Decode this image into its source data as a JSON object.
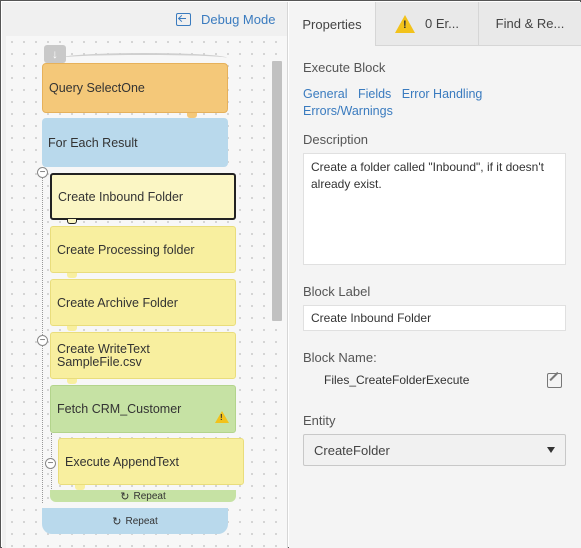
{
  "canvas": {
    "debug_label": "Debug Mode",
    "blocks": {
      "query": "Query SelectOne",
      "foreach": "For Each Result",
      "create_inbound": "Create Inbound Folder",
      "processing": "Create Processing folder",
      "archive": "Create Archive Folder",
      "writetext": "Create WriteText SampleFile.csv",
      "fetch": "Fetch CRM_Customer",
      "append": "Execute AppendText",
      "repeat_inner": "Repeat",
      "repeat_outer": "Repeat"
    },
    "colors": {
      "query": "#f4c879",
      "foreach": "#b9d9ec",
      "yellow": "#f8ef9f",
      "green": "#c6e2a4",
      "warning": "#f2c21b"
    }
  },
  "tabs": {
    "properties": "Properties",
    "errors": "0 Er...",
    "find": "Find & Re..."
  },
  "properties": {
    "section_title": "Execute Block",
    "links": [
      "General",
      "Fields",
      "Error Handling",
      "Errors/Warnings"
    ],
    "description_label": "Description",
    "description_value": "Create a folder called \"Inbound\", if it doesn't already exist.",
    "block_label_label": "Block Label",
    "block_label_value": "Create Inbound Folder",
    "block_name_label": "Block Name:",
    "block_name_value": "Files_CreateFolderExecute",
    "entity_label": "Entity",
    "entity_value": "CreateFolder"
  }
}
